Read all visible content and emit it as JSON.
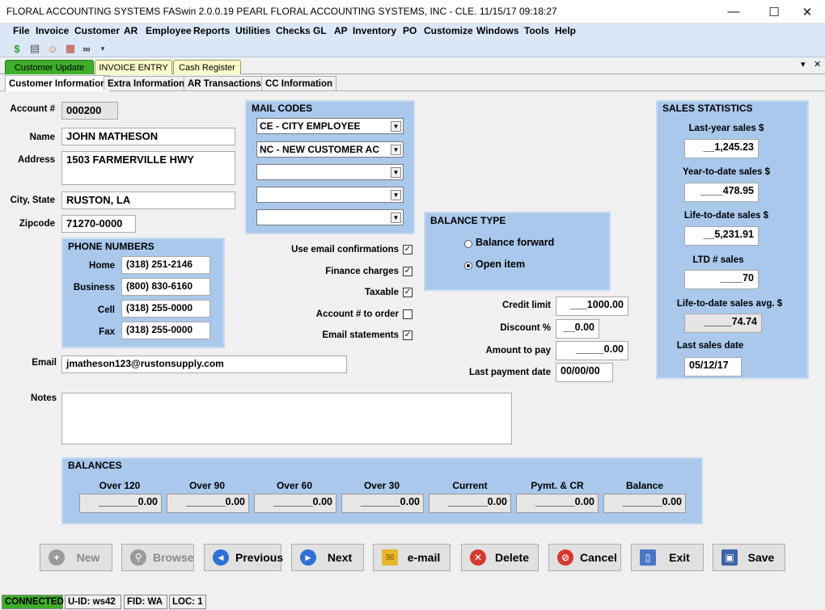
{
  "window": {
    "title": "FLORAL ACCOUNTING SYSTEMS  FASwin 2.0.0.19   PEARL   FLORAL ACCOUNTING SYSTEMS, INC - CLE.   11/15/17  09:18:27",
    "minimize": "—",
    "maximize": "☐",
    "close": "✕"
  },
  "menu": [
    "File",
    "Invoice",
    "Customer",
    "AR",
    "Employee",
    "Reports",
    "Utilities",
    "Checks",
    "GL",
    "AP",
    "Inventory",
    "PO",
    "Customize",
    "Windows",
    "Tools",
    "Help"
  ],
  "toolbar_icons": [
    "dollar-icon",
    "register-icon",
    "person-icon",
    "calculator-icon",
    "binoculars-icon"
  ],
  "doc_tabs": [
    "Customer Update",
    "INVOICE ENTRY",
    "Cash Register"
  ],
  "sub_tabs": [
    "Customer Information",
    "Extra Information",
    "AR Transactions",
    "CC Information"
  ],
  "customer": {
    "account_label": "Account #",
    "account": "000200",
    "name_label": "Name",
    "name": "JOHN MATHESON",
    "address_label": "Address",
    "address": "1503 FARMERVILLE HWY",
    "city_label": "City, State",
    "city": "RUSTON, LA",
    "zip_label": "Zipcode",
    "zip": "71270-0000",
    "email_label": "Email",
    "email": "jmatheson123@rustonsupply.com",
    "notes_label": "Notes",
    "notes": ""
  },
  "phone": {
    "title": "PHONE NUMBERS",
    "rows": [
      {
        "label": "Home",
        "value": "(318) 251-2146"
      },
      {
        "label": "Business",
        "value": "(800) 830-6160"
      },
      {
        "label": "Cell",
        "value": "(318) 255-0000"
      },
      {
        "label": "Fax",
        "value": "(318) 255-0000"
      }
    ]
  },
  "mail_codes": {
    "title": "MAIL CODES",
    "values": [
      "CE - CITY EMPLOYEE",
      "NC - NEW CUSTOMER AC",
      "",
      "",
      ""
    ]
  },
  "options": [
    {
      "label": "Use email confirmations",
      "mark": "✓"
    },
    {
      "label": "Finance charges",
      "mark": "✓"
    },
    {
      "label": "Taxable",
      "mark": "✓"
    },
    {
      "label": "Account # to order",
      "mark": ""
    },
    {
      "label": "Email statements",
      "mark": "✓"
    }
  ],
  "balance_type": {
    "title": "BALANCE TYPE",
    "options": [
      "Balance forward",
      "Open item"
    ],
    "selected_index": 1
  },
  "credit": {
    "rows": [
      {
        "label": "Credit limit",
        "value": "___1000.00"
      },
      {
        "label": "Discount %",
        "value": "__0.00"
      },
      {
        "label": "Amount to pay",
        "value": "_____0.00"
      },
      {
        "label": "Last payment date",
        "value": "00/00/00"
      }
    ]
  },
  "sales": {
    "title": "SALES STATISTICS",
    "rows": [
      {
        "label": "Last-year sales $",
        "value": "__1,245.23"
      },
      {
        "label": "Year-to-date sales $",
        "value": "____478.95"
      },
      {
        "label": "Life-to-date sales $",
        "value": "__5,231.91"
      },
      {
        "label": "LTD  #  sales",
        "value": "____70"
      },
      {
        "label": "Life-to-date sales avg. $",
        "value": "_____74.74"
      },
      {
        "label": "Last sales date",
        "value": "05/12/17"
      }
    ]
  },
  "balances": {
    "title": "BALANCES",
    "columns": [
      {
        "label": "Over 120",
        "value": "_______0.00"
      },
      {
        "label": "Over 90",
        "value": "_______0.00"
      },
      {
        "label": "Over 60",
        "value": "_______0.00"
      },
      {
        "label": "Over 30",
        "value": "_______0.00"
      },
      {
        "label": "Current",
        "value": "_______0.00"
      },
      {
        "label": "Pymt. & CR",
        "value": "_______0.00"
      },
      {
        "label": "Balance",
        "value": "_______0.00"
      }
    ]
  },
  "buttons": [
    {
      "label": "New",
      "icon": "plus-icon",
      "color": "#9a9a9a",
      "glyph": "+"
    },
    {
      "label": "Browse",
      "icon": "search-icon",
      "color": "#9a9a9a",
      "glyph": "⚲"
    },
    {
      "label": "Previous",
      "icon": "arrow-left-icon",
      "color": "#2f6fd6",
      "glyph": "◀"
    },
    {
      "label": "Next",
      "icon": "arrow-right-icon",
      "color": "#2f6fd6",
      "glyph": "▶"
    },
    {
      "label": "e-mail",
      "icon": "envelope-icon",
      "color": "#e8b62a",
      "glyph": "✉"
    },
    {
      "label": "Delete",
      "icon": "delete-icon",
      "color": "#d63a2f",
      "glyph": "✕"
    },
    {
      "label": "Cancel",
      "icon": "cancel-icon",
      "color": "#d63a2f",
      "glyph": "⊘"
    },
    {
      "label": "Exit",
      "icon": "exit-door-icon",
      "color": "#4a78c8",
      "glyph": "▯"
    },
    {
      "label": "Save",
      "icon": "floppy-disk-icon",
      "color": "#3e64a8",
      "glyph": "▣"
    }
  ],
  "status": {
    "connected": "CONNECTED",
    "uid": "U-ID: ws42",
    "fid": "FID: WA",
    "loc": "LOC: 1"
  },
  "colors": {
    "panel": "#a9c8ec",
    "menu": "#dbe7f7",
    "active_tab": "#3fae2a",
    "connected": "#3fae2a"
  }
}
